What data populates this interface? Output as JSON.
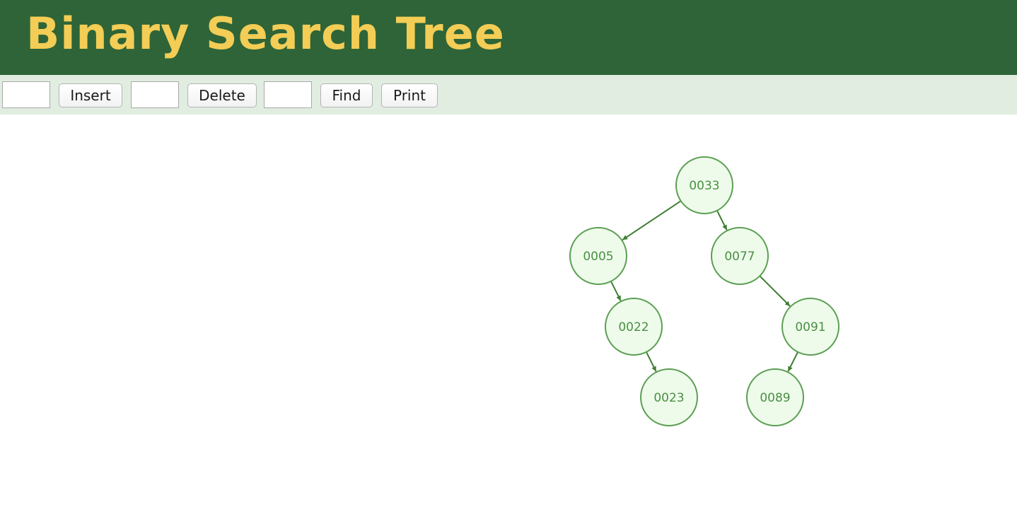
{
  "header": {
    "title": "Binary Search Tree"
  },
  "toolbar": {
    "insert_input_value": "",
    "insert_label": "Insert",
    "delete_input_value": "",
    "delete_label": "Delete",
    "find_input_value": "",
    "find_label": "Find",
    "print_label": "Print"
  },
  "colors": {
    "header_bg": "#2e6437",
    "title_text": "#f3cd55",
    "toolbar_bg": "#e1ede0",
    "node_fill": "#eefbeb",
    "node_stroke": "#5c9f53",
    "node_text": "#4a8f42",
    "edge": "#3f7d32"
  },
  "tree": {
    "nodes": [
      {
        "id": "n33",
        "label": "0033"
      },
      {
        "id": "n5",
        "label": "0005"
      },
      {
        "id": "n77",
        "label": "0077"
      },
      {
        "id": "n22",
        "label": "0022"
      },
      {
        "id": "n91",
        "label": "0091"
      },
      {
        "id": "n23",
        "label": "0023"
      },
      {
        "id": "n89",
        "label": "0089"
      }
    ],
    "edges": [
      {
        "from": "n33",
        "to": "n5"
      },
      {
        "from": "n33",
        "to": "n77"
      },
      {
        "from": "n5",
        "to": "n22"
      },
      {
        "from": "n77",
        "to": "n91"
      },
      {
        "from": "n22",
        "to": "n23"
      },
      {
        "from": "n91",
        "to": "n89"
      }
    ]
  }
}
